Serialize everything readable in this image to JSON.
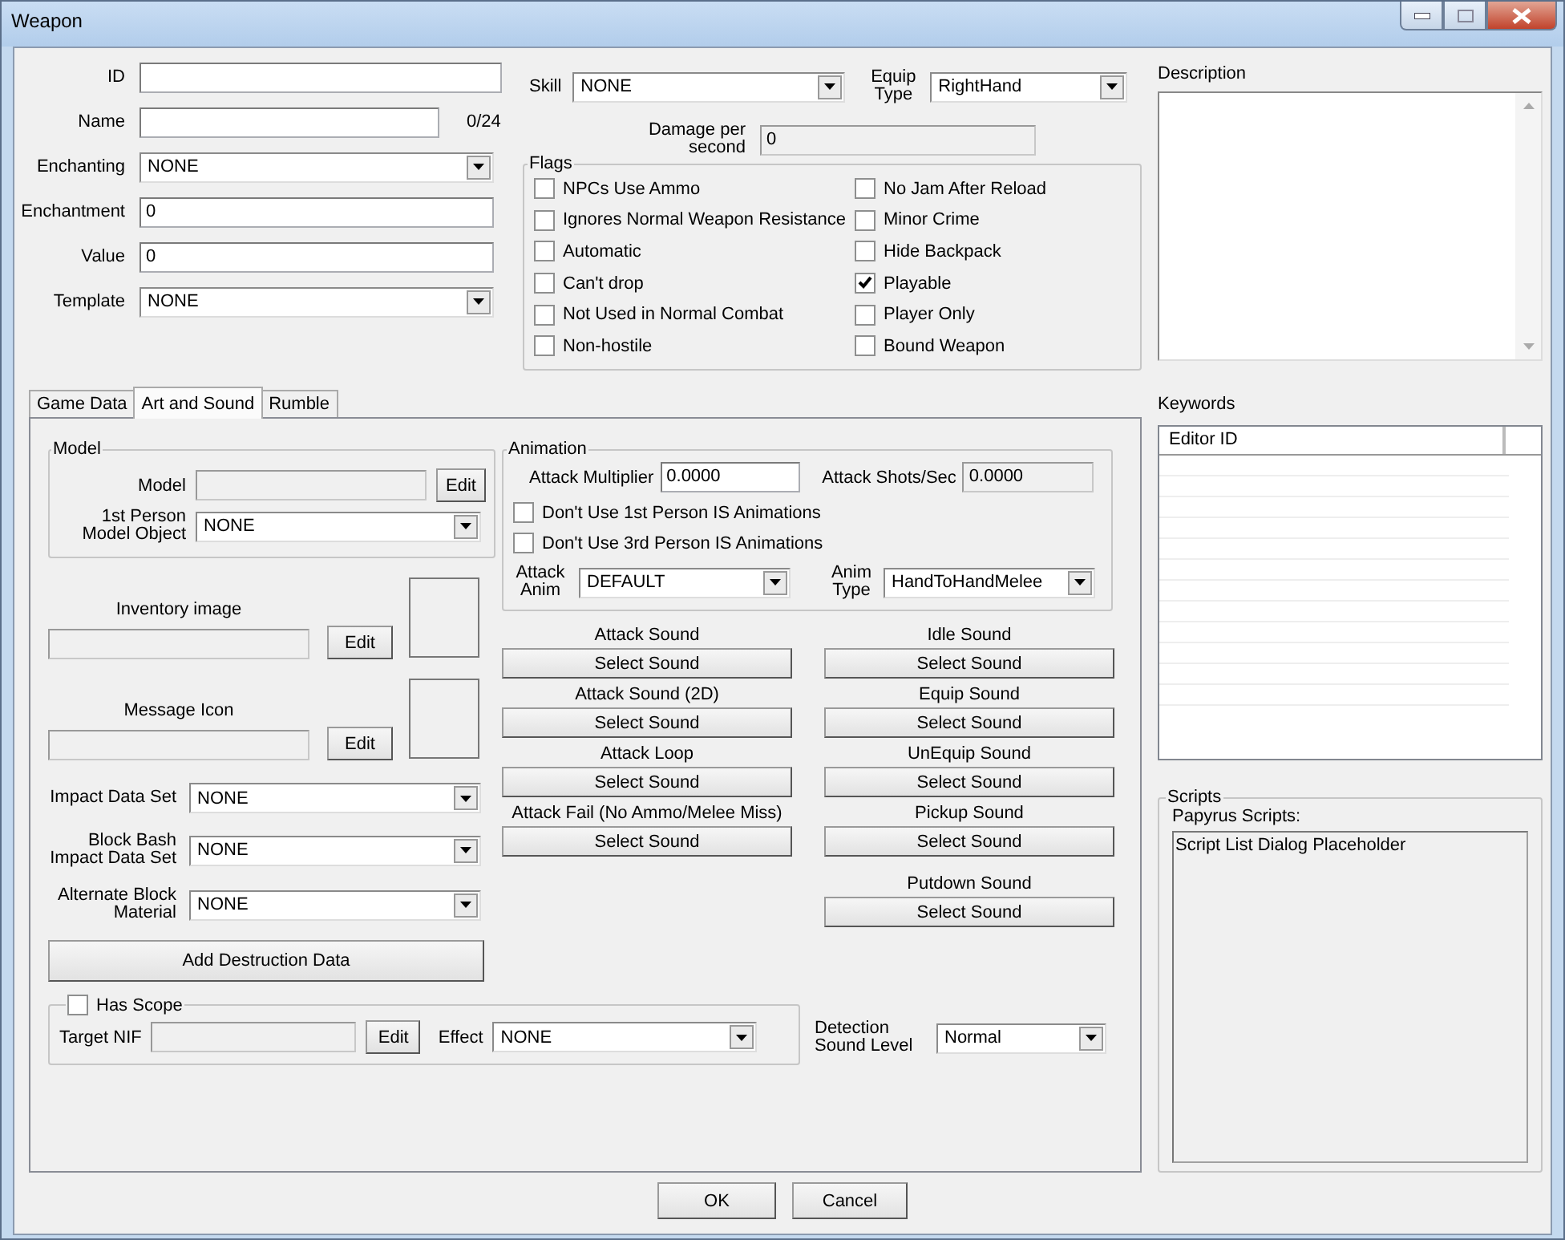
{
  "window": {
    "title": "Weapon"
  },
  "form": [
    {
      "label": "ID",
      "kind": "text"
    },
    {
      "label": "Name",
      "kind": "text",
      "counter": "0/24"
    },
    {
      "label": "Enchanting",
      "kind": "dropdown",
      "value": "NONE"
    },
    {
      "label": "Enchantment",
      "kind": "text",
      "value": "0"
    },
    {
      "label": "Value",
      "kind": "text",
      "value": "0"
    },
    {
      "label": "Template",
      "kind": "dropdown",
      "value": "NONE"
    }
  ],
  "skill": {
    "label": "Skill",
    "value": "NONE"
  },
  "equip_type": {
    "label": "Equip Type",
    "value": "RightHand"
  },
  "damage_per_second": {
    "label": "Damage per second",
    "value": "0",
    "disabled": true
  },
  "flags": {
    "title": "Flags",
    "items": [
      {
        "label": "NPCs Use Ammo",
        "checked": false
      },
      {
        "label": "Ignores Normal Weapon Resistance",
        "checked": false
      },
      {
        "label": "Automatic",
        "checked": false
      },
      {
        "label": "Can't drop",
        "checked": false
      },
      {
        "label": "Not Used in Normal Combat",
        "checked": false
      },
      {
        "label": "Non-hostile",
        "checked": false
      },
      {
        "label": "No Jam After Reload",
        "checked": false
      },
      {
        "label": "Minor Crime",
        "checked": false
      },
      {
        "label": "Hide Backpack",
        "checked": false
      },
      {
        "label": "Playable",
        "checked": true
      },
      {
        "label": "Player Only",
        "checked": false
      },
      {
        "label": "Bound Weapon",
        "checked": false
      }
    ]
  },
  "tabs": [
    {
      "label": "Game Data",
      "selected": false
    },
    {
      "label": "Art and Sound",
      "selected": true
    },
    {
      "label": "Rumble",
      "selected": false
    }
  ],
  "art_and_sound": {
    "model_group": {
      "title": "Model",
      "model": {
        "label": "Model",
        "button": "Edit",
        "disabled": true
      },
      "first_person": {
        "label": "1st Person Model Object",
        "value": "NONE"
      }
    },
    "images": [
      {
        "label": "Inventory image",
        "button": "Edit",
        "disabled": true
      },
      {
        "label": "Message Icon",
        "button": "Edit",
        "disabled": true
      }
    ],
    "dropdowns": [
      {
        "label": "Impact Data Set",
        "value": "NONE"
      },
      {
        "label": "Block Bash Impact Data Set",
        "value": "NONE"
      },
      {
        "label": "Alternate Block Material",
        "value": "NONE"
      }
    ],
    "destruction_button": "Add Destruction Data",
    "scope": {
      "label": "Has Scope",
      "checked": false,
      "target_label": "Target NIF",
      "target_disabled": true,
      "button": "Edit",
      "effect_label": "Effect",
      "effect_value": "NONE"
    },
    "animation": {
      "title": "Animation",
      "attack_multiplier": {
        "label": "Attack Multiplier",
        "value": "0.0000",
        "disabled": false
      },
      "attack_shots": {
        "label": "Attack Shots/Sec",
        "value": "0.0000",
        "disabled": true
      },
      "checks": [
        {
          "label": "Don't Use 1st Person IS Animations",
          "checked": false
        },
        {
          "label": "Don't Use 3rd Person IS Animations",
          "checked": false
        }
      ],
      "attack_anim": {
        "label": "Attack Anim",
        "value": "DEFAULT"
      },
      "anim_type": {
        "label": "Anim Type",
        "value": "HandToHandMelee"
      }
    },
    "sounds_left": [
      {
        "label": "Attack Sound",
        "button": "Select Sound"
      },
      {
        "label": "Attack Sound  (2D)",
        "button": "Select Sound"
      },
      {
        "label": "Attack Loop",
        "button": "Select Sound"
      },
      {
        "label": "Attack Fail (No Ammo/Melee Miss)",
        "button": "Select Sound"
      }
    ],
    "sounds_right": [
      {
        "label": "Idle Sound",
        "button": "Select Sound"
      },
      {
        "label": "Equip Sound",
        "button": "Select Sound"
      },
      {
        "label": "UnEquip Sound",
        "button": "Select Sound"
      },
      {
        "label": "Pickup Sound",
        "button": "Select Sound"
      },
      {
        "label": "Putdown Sound",
        "button": "Select Sound"
      }
    ],
    "detection": {
      "label": "Detection Sound Level",
      "value": "Normal"
    }
  },
  "description": {
    "label": "Description"
  },
  "keywords": {
    "label": "Keywords",
    "columns": [
      "Editor ID"
    ]
  },
  "scripts": {
    "title": "Scripts",
    "label": "Papyrus Scripts:",
    "items": [
      "Script List Dialog Placeholder"
    ]
  },
  "buttons": [
    "OK",
    "Cancel"
  ]
}
